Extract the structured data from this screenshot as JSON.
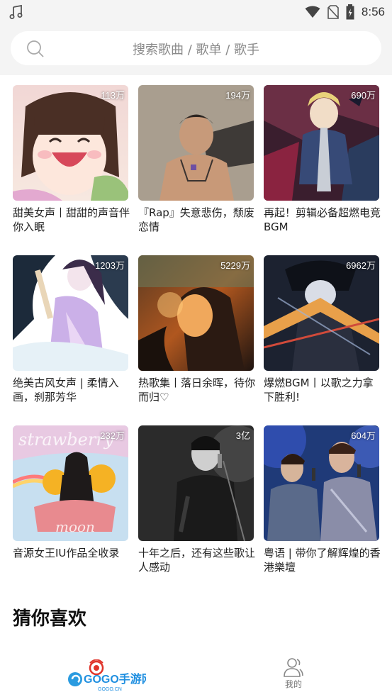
{
  "status_bar": {
    "time": "8:56"
  },
  "search": {
    "placeholder": "搜索歌曲 / 歌单 / 歌手"
  },
  "playlists": [
    {
      "count": "113万",
      "title": "甜美女声丨甜甜的声音伴你入眠"
    },
    {
      "count": "194万",
      "title": "『Rap』失意悲伤，颓废恋情"
    },
    {
      "count": "690万",
      "title": "再起！剪辑必备超燃电竞BGM"
    },
    {
      "count": "1203万",
      "title": "绝美古风女声 | 柔情入画，刹那芳华"
    },
    {
      "count": "5229万",
      "title": "热歌集丨落日余晖，待你而归♡"
    },
    {
      "count": "6962万",
      "title": "爆燃BGM丨以歌之力拿下胜利!"
    },
    {
      "count": "232万",
      "title": "音源女王IU作品全收录"
    },
    {
      "count": "3亿",
      "title": "十年之后，还有这些歌让人感动"
    },
    {
      "count": "604万",
      "title": "粤语 | 带你了解辉煌的香港樂壇"
    }
  ],
  "section": {
    "title": "猜你喜欢"
  },
  "tabbar": {
    "logo_text": "GOGO手游网",
    "logo_sub": "GOGO.CN",
    "mine_label": "我的"
  }
}
